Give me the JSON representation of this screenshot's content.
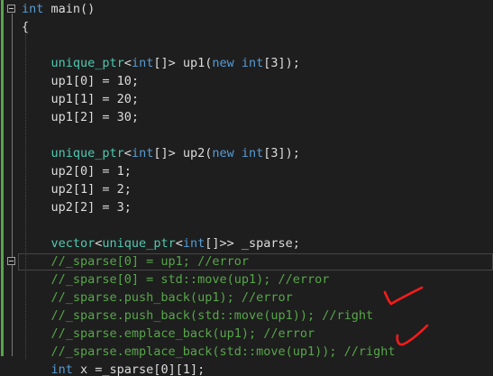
{
  "code_lines": [
    [
      {
        "t": "int",
        "c": "kw"
      },
      {
        "t": " main()",
        "c": "tx"
      }
    ],
    [
      {
        "t": "{",
        "c": "tx"
      }
    ],
    [],
    [
      {
        "t": "    unique_ptr",
        "c": "ty"
      },
      {
        "t": "<",
        "c": "tx"
      },
      {
        "t": "int",
        "c": "kw"
      },
      {
        "t": "[]> up1(",
        "c": "tx"
      },
      {
        "t": "new",
        "c": "kw"
      },
      {
        "t": " ",
        "c": "tx"
      },
      {
        "t": "int",
        "c": "kw"
      },
      {
        "t": "[3]);",
        "c": "tx"
      }
    ],
    [
      {
        "t": "    up1[0] = 10;",
        "c": "tx"
      }
    ],
    [
      {
        "t": "    up1[1] = 20;",
        "c": "tx"
      }
    ],
    [
      {
        "t": "    up1[2] = 30;",
        "c": "tx"
      }
    ],
    [],
    [
      {
        "t": "    unique_ptr",
        "c": "ty"
      },
      {
        "t": "<",
        "c": "tx"
      },
      {
        "t": "int",
        "c": "kw"
      },
      {
        "t": "[]> up2(",
        "c": "tx"
      },
      {
        "t": "new",
        "c": "kw"
      },
      {
        "t": " ",
        "c": "tx"
      },
      {
        "t": "int",
        "c": "kw"
      },
      {
        "t": "[3]);",
        "c": "tx"
      }
    ],
    [
      {
        "t": "    up2[0] = 1;",
        "c": "tx"
      }
    ],
    [
      {
        "t": "    up2[1] = 2;",
        "c": "tx"
      }
    ],
    [
      {
        "t": "    up2[2] = 3;",
        "c": "tx"
      }
    ],
    [],
    [
      {
        "t": "    vector",
        "c": "ty"
      },
      {
        "t": "<",
        "c": "tx"
      },
      {
        "t": "unique_ptr",
        "c": "ty"
      },
      {
        "t": "<",
        "c": "tx"
      },
      {
        "t": "int",
        "c": "kw"
      },
      {
        "t": "[]>> _sparse;",
        "c": "tx"
      }
    ],
    [
      {
        "t": "    //_sparse[0] = up1; //error",
        "c": "cm"
      }
    ],
    [
      {
        "t": "    //_sparse[0] = std::move(up1); //error",
        "c": "cm"
      }
    ],
    [
      {
        "t": "    //_sparse.push_back(up1); //error",
        "c": "cm"
      }
    ],
    [
      {
        "t": "    //_sparse.push_back(std::move(up1)); //right",
        "c": "cm"
      }
    ],
    [
      {
        "t": "    //_sparse.emplace_back(up1); //error",
        "c": "cm"
      }
    ],
    [
      {
        "t": "    //_sparse.emplace_back(std::move(up1)); //right",
        "c": "cm"
      }
    ],
    [
      {
        "t": "    ",
        "c": "tx"
      },
      {
        "t": "int",
        "c": "kw"
      },
      {
        "t": " x =_sparse[0][1];",
        "c": "tx"
      }
    ]
  ],
  "highlighted_line": 14,
  "fold_markers": [
    0,
    14
  ],
  "colors": {
    "keyword": "#569cd6",
    "type": "#4ec9b0",
    "text": "#dcdcdc",
    "comment": "#57a64a",
    "annotation_ink": "#ff1a1a",
    "change_bar": "#57a64a"
  },
  "annotations": [
    {
      "name": "checkmark-ink-1",
      "after_line": 17
    },
    {
      "name": "checkmark-ink-2",
      "after_line": 19
    }
  ]
}
